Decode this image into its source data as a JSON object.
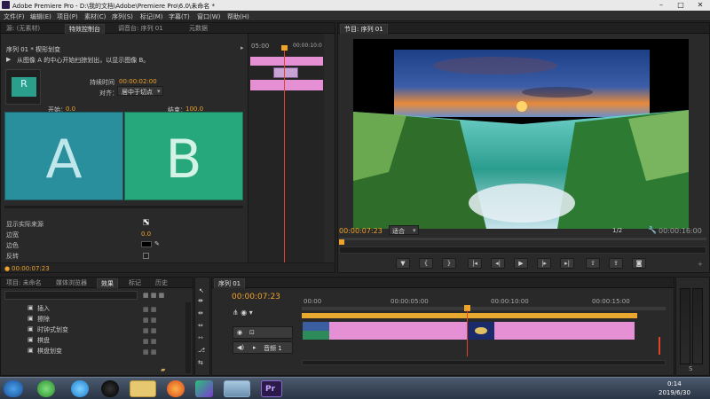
{
  "window": {
    "title": "Adobe Premiere Pro - D:\\我的文档\\Adobe\\Premiere Pro\\6.0\\未命名 *"
  },
  "menu": [
    "文件(F)",
    "编辑(E)",
    "项目(P)",
    "素材(C)",
    "序列(S)",
    "标记(M)",
    "字幕(T)",
    "窗口(W)",
    "帮助(H)"
  ],
  "left_panel": {
    "tabs": [
      "源: (无素材)",
      "特效控制台",
      "调音台: 序列 01",
      "元数据"
    ],
    "sequence_label": "序列 01 * 楔形划变",
    "description": "从图像 A 的中心开始扫掠划出，以显示图像 B。",
    "duration_label": "持续时间",
    "duration_value": "00:00:02:00",
    "align_label": "对齐：",
    "align_value": "居中于切点",
    "start_label": "开始：",
    "start_value": "0.0",
    "end_label": "结束：",
    "end_value": "100.0",
    "letter_a": "A",
    "letter_b": "B",
    "preview_letter": "R",
    "show_actual_label": "显示实际来源",
    "border_width_label": "边宽",
    "border_width_value": "0.0",
    "border_color_label": "边色",
    "reverse_label": "反转",
    "timecode": "00:00:07:23",
    "mini_timeline": {
      "start": "05:00",
      "end": "00:00:10:0"
    }
  },
  "program": {
    "tab": "节目: 序列 01",
    "timecode": "00:00:07:23",
    "fit_label": "适合",
    "page": "1/2",
    "duration": "00:00:16:00"
  },
  "project_panel": {
    "tabs": [
      "项目: 未命名",
      "媒体浏览器",
      "效果",
      "标记",
      "历史"
    ],
    "items": [
      "插入",
      "擦除",
      "时钟式划变",
      "棋盘",
      "棋盘划变"
    ]
  },
  "timeline": {
    "tab": "序列 01",
    "timecode": "00:00:07:23",
    "ruler": [
      "00:00",
      "00:00:05:00",
      "00:00:10:00",
      "00:00:15:00"
    ],
    "audio_track": "音频 1"
  },
  "taskbar": {
    "time": "0:14",
    "date": "2019/6/30"
  },
  "colors": {
    "accent": "#f0a32a",
    "playhead": "#e0452a",
    "clip_pink": "#e58fd4"
  }
}
